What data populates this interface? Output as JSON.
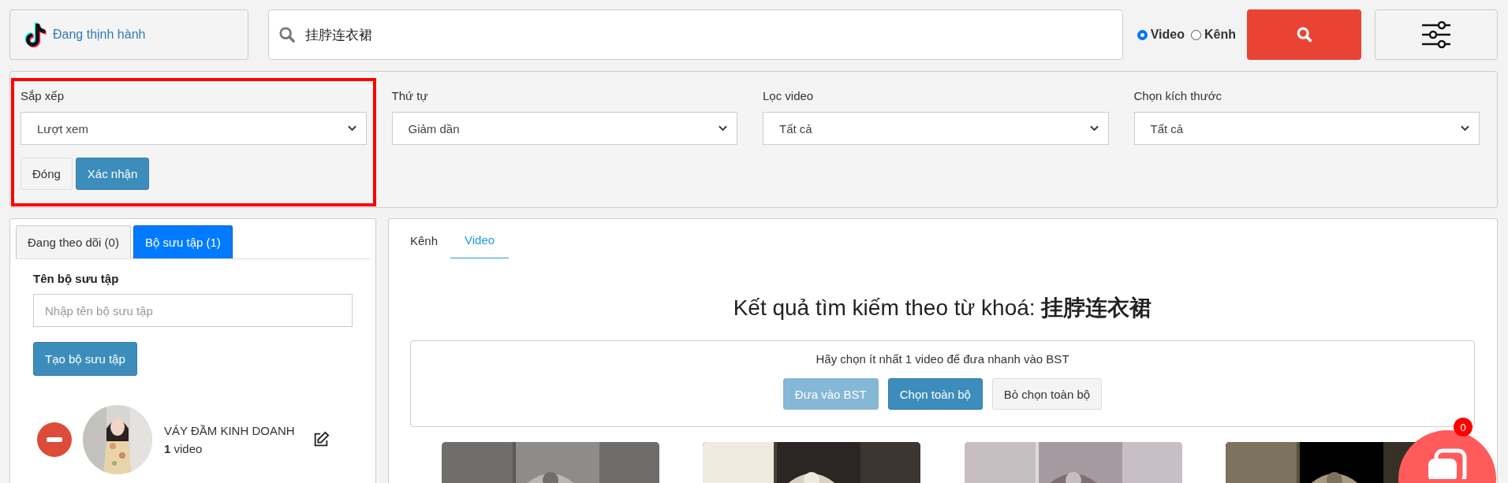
{
  "header": {
    "trending_link": "Đang thịnh hành",
    "search": {
      "value": "挂脖连衣裙"
    },
    "search_type": [
      {
        "label": "Video",
        "selected": true
      },
      {
        "label": "Kênh",
        "selected": false
      }
    ]
  },
  "filters": [
    {
      "label": "Sắp xếp",
      "value": "Lượt xem",
      "highlighted": true
    },
    {
      "label": "Thứ tự",
      "value": "Giảm dần",
      "highlighted": false
    },
    {
      "label": "Lọc video",
      "value": "Tất cả",
      "highlighted": false
    },
    {
      "label": "Chọn kích thước",
      "value": "Tất cả",
      "highlighted": false
    }
  ],
  "filter_actions": [
    {
      "label": "Đóng",
      "kind": "default"
    },
    {
      "label": "Xác nhận",
      "kind": "primary"
    }
  ],
  "sidebar": {
    "tabs": [
      {
        "label": "Đang theo dõi (0)",
        "selected": false
      },
      {
        "label": "Bộ sưu tập (1)",
        "selected": true
      }
    ],
    "form_label": "Tên bộ sưu tập",
    "name_field": {
      "placeholder": "Nhập tên bộ sưu tập"
    },
    "create_button": "Tạo bộ sưu tập",
    "collections": [
      {
        "name": "VÁY ĐẦM KINH DOANH",
        "count": "**1** video"
      }
    ]
  },
  "results": {
    "tabs": [
      {
        "label": "Kênh",
        "selected": false
      },
      {
        "label": "Video",
        "selected": true
      }
    ],
    "heading": "Kết quả tìm kiếm theo từ khoá: **挂脖连衣裙**",
    "hint": "Hãy chọn ít nhất 1 video để đưa nhanh vào BST",
    "actions": [
      {
        "label": "Đưa vào BST",
        "kind": "primary",
        "disabled": true
      },
      {
        "label": "Chọn toàn bộ",
        "kind": "primary",
        "disabled": false
      },
      {
        "label": "Bỏ chọn toàn bộ",
        "kind": "default",
        "disabled": false
      }
    ]
  },
  "chat_badge": "0"
}
